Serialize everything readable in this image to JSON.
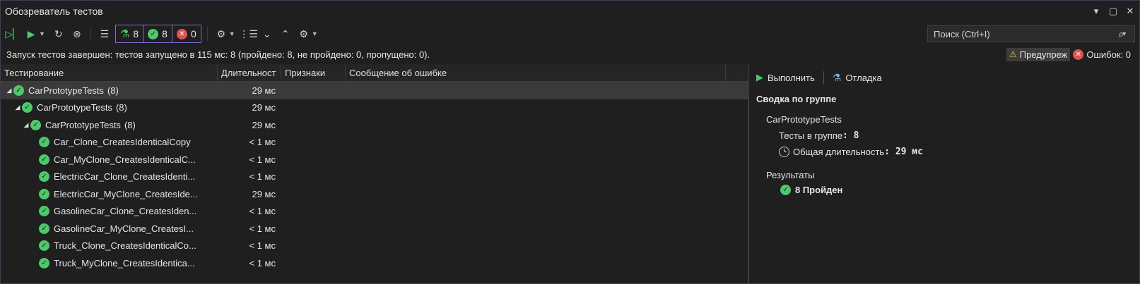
{
  "window": {
    "title": "Обозреватель тестов"
  },
  "counters": {
    "total": "8",
    "passed": "8",
    "failed": "0"
  },
  "search": {
    "placeholder": "Поиск (Ctrl+I)"
  },
  "status": {
    "message": "Запуск тестов завершен: тестов запущено в 115 мс: 8 (пройдено: 8, не пройдено: 0, пропущено: 0).",
    "warnings_label": "Предупреж",
    "errors_label": "Ошибок: 0"
  },
  "columns": [
    "Тестирование",
    "Длительност",
    "Признаки",
    "Сообщение об ошибке"
  ],
  "tree": [
    {
      "name": "CarPrototypeTests",
      "count": "(8)",
      "duration": "29 мс",
      "level": 0,
      "expanded": true
    },
    {
      "name": "CarPrototypeTests",
      "count": "(8)",
      "duration": "29 мс",
      "level": 1,
      "expanded": true
    },
    {
      "name": "CarPrototypeTests",
      "count": "(8)",
      "duration": "29 мс",
      "level": 2,
      "expanded": true
    },
    {
      "name": "Car_Clone_CreatesIdenticalCopy",
      "count": "",
      "duration": "< 1 мс",
      "level": 3
    },
    {
      "name": "Car_MyClone_CreatesIdenticalC...",
      "count": "",
      "duration": "< 1 мс",
      "level": 3
    },
    {
      "name": "ElectricCar_Clone_CreatesIdenti...",
      "count": "",
      "duration": "< 1 мс",
      "level": 3
    },
    {
      "name": "ElectricCar_MyClone_CreatesIde...",
      "count": "",
      "duration": "29 мс",
      "level": 3
    },
    {
      "name": "GasolineCar_Clone_CreatesIden...",
      "count": "",
      "duration": "< 1 мс",
      "level": 3
    },
    {
      "name": "GasolineCar_MyClone_CreatesI...",
      "count": "",
      "duration": "< 1 мс",
      "level": 3
    },
    {
      "name": "Truck_Clone_CreatesIdenticalCo...",
      "count": "",
      "duration": "< 1 мс",
      "level": 3
    },
    {
      "name": "Truck_MyClone_CreatesIdentica...",
      "count": "",
      "duration": "< 1 мс",
      "level": 3
    }
  ],
  "details": {
    "run_label": "Выполнить",
    "debug_label": "Отладка",
    "summary_title": "Сводка по группе",
    "group_name": "CarPrototypeTests",
    "tests_in_group_label": "Тесты в группе",
    "tests_in_group_value": ": 8",
    "duration_label": "Общая длительность",
    "duration_value": ": 29 мс",
    "results_label": "Результаты",
    "results_passed": "8 Пройден"
  }
}
